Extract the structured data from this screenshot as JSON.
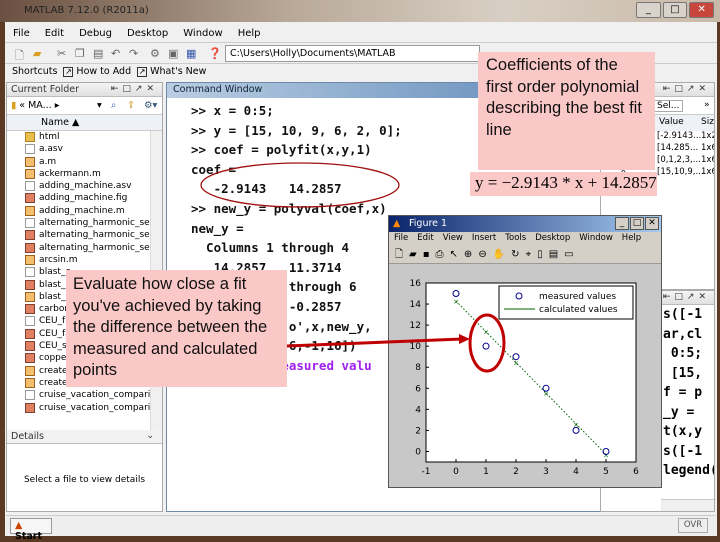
{
  "window": {
    "title": "MATLAB  7.12.0 (R2011a)",
    "controls": [
      "_",
      "□",
      "✕"
    ]
  },
  "menu": [
    "File",
    "Edit",
    "Debug",
    "Desktop",
    "Window",
    "Help"
  ],
  "toolbar": {
    "current_path": "C:\\Users\\Holly\\Documents\\MATLAB"
  },
  "shortcuts": {
    "label": "Shortcuts",
    "items": [
      "How to Add",
      "What's New"
    ]
  },
  "current_folder": {
    "title": "Current Folder",
    "nav_path": "« MA... ▸",
    "column_name": "Name ▲",
    "files": [
      {
        "name": "html",
        "type": "dir"
      },
      {
        "name": "a.asv",
        "type": "file"
      },
      {
        "name": "a.m",
        "type": "m"
      },
      {
        "name": "ackermann.m",
        "type": "m"
      },
      {
        "name": "adding_machine.asv",
        "type": "file"
      },
      {
        "name": "adding_machine.fig",
        "type": "fig"
      },
      {
        "name": "adding_machine.m",
        "type": "m"
      },
      {
        "name": "alternating_harmonic_seri...",
        "type": "file"
      },
      {
        "name": "alternating_harmonic_seri...",
        "type": "fig"
      },
      {
        "name": "alternating_harmonic_seri...",
        "type": "fig"
      },
      {
        "name": "arcsin.m",
        "type": "m"
      },
      {
        "name": "blast_o",
        "type": "file"
      },
      {
        "name": "blast_o",
        "type": "fig"
      },
      {
        "name": "blast_m",
        "type": "m"
      },
      {
        "name": "carbon",
        "type": "fig"
      },
      {
        "name": "CEU_fa",
        "type": "file"
      },
      {
        "name": "CEU_fa",
        "type": "fig"
      },
      {
        "name": "CEU_se",
        "type": "fig"
      },
      {
        "name": "copper",
        "type": "fig"
      },
      {
        "name": "createfigure.m",
        "type": "m"
      },
      {
        "name": "createfigure1.m",
        "type": "m"
      },
      {
        "name": "cruise_vacation_comparis...",
        "type": "file"
      },
      {
        "name": "cruise_vacation_comparis...",
        "type": "fig"
      }
    ],
    "details_title": "Details",
    "details_text": "Select a file to view details"
  },
  "command_window": {
    "title": "Command Window",
    "lines": [
      {
        "text": ">> x = 0:5;",
        "kind": "code"
      },
      {
        "text": ">> y = [15, 10, 9, 6, 2, 0];",
        "kind": "code"
      },
      {
        "text": ">> coef = polyfit(x,y,1)",
        "kind": "code"
      },
      {
        "text": "coef =",
        "kind": "code"
      },
      {
        "text": "   -2.9143   14.2857",
        "kind": "code"
      },
      {
        "text": ">> new_y = polyval(coef,x)",
        "kind": "code"
      },
      {
        "text": "new_y =",
        "kind": "code"
      },
      {
        "text": "  Columns 1 through 4",
        "kind": "code"
      },
      {
        "text": "   14.2857   11.3714",
        "kind": "code"
      },
      {
        "text": "             through 6",
        "kind": "code"
      },
      {
        "text": "             -0.2857",
        "kind": "code"
      },
      {
        "text": "            'o',x,new_y,",
        "kind": "code"
      },
      {
        "text": "             6,-1,16])",
        "kind": "code"
      },
      {
        "text": "           measured valu",
        "kind": "str"
      }
    ]
  },
  "workspace": {
    "select_label": "Sel...",
    "columns": [
      "Value",
      "Siz"
    ],
    "rows": [
      {
        "value": "[-2.9143...",
        "size": "1x2"
      },
      {
        "value": "[14.285...",
        "size": "1x6"
      },
      {
        "value": "[0,1,2,3,...",
        "size": "1x6"
      },
      {
        "value": "[15,10,9,...",
        "size": "1x6"
      }
    ],
    "visible_name": "x"
  },
  "command_history": {
    "lines": [
      "s([-1",
      "ar,cl",
      " 0:5;",
      " [15,",
      "f = p",
      "_y = ",
      "t(x,y",
      "s([-1",
      "legend('"
    ]
  },
  "status": {
    "start_label": "Start",
    "mode": "OVR"
  },
  "figure": {
    "title": "Figure 1",
    "menu": [
      "File",
      "Edit",
      "View",
      "Insert",
      "Tools",
      "Desktop",
      "Window",
      "Help"
    ]
  },
  "chart_data": {
    "type": "scatter",
    "title": "",
    "xlabel": "",
    "ylabel": "",
    "xlim": [
      -1,
      6
    ],
    "ylim": [
      -1,
      16
    ],
    "xticks": [
      -1,
      0,
      1,
      2,
      3,
      4,
      5,
      6
    ],
    "yticks": [
      0,
      2,
      4,
      6,
      8,
      10,
      12,
      14,
      16
    ],
    "legend_position": "top-right",
    "series": [
      {
        "name": "measured values",
        "marker": "o",
        "color": "#00008b",
        "x": [
          0,
          1,
          2,
          3,
          4,
          5
        ],
        "y": [
          15,
          10,
          9,
          6,
          2,
          0
        ]
      },
      {
        "name": "calculated values",
        "marker": "x",
        "line": "dotted",
        "color": "#006400",
        "x": [
          0,
          1,
          2,
          3,
          4,
          5
        ],
        "y": [
          14.2857,
          11.3714,
          8.4571,
          5.5429,
          2.6286,
          -0.2857
        ]
      }
    ]
  },
  "annotations": {
    "top_callout": "Coefficients of the first order polynomial describing the best fit line",
    "equation": "y = −2.9143 * x + 14.2857",
    "left_callout": "Evaluate how close a fit you've achieved by taking the difference between the measured and calculated points",
    "highlight_color": "#c00000"
  }
}
